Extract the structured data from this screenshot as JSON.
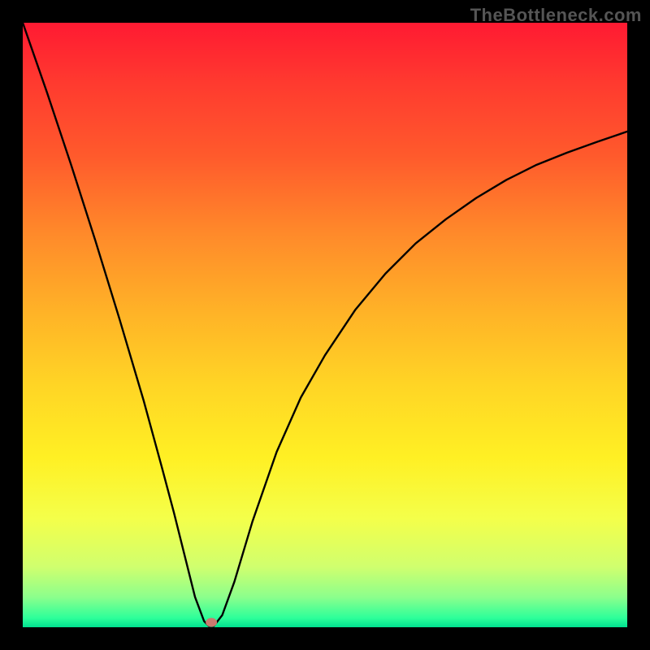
{
  "watermark": "TheBottleneck.com",
  "chart_data": {
    "type": "line",
    "title": "",
    "xlabel": "",
    "ylabel": "",
    "xlim": [
      0,
      100
    ],
    "ylim": [
      0,
      100
    ],
    "x": [
      0,
      4,
      8,
      12,
      16,
      20,
      23,
      25,
      27,
      28.5,
      30,
      30.8,
      31.6,
      33,
      35,
      38,
      42,
      46,
      50,
      55,
      60,
      65,
      70,
      75,
      80,
      85,
      90,
      95,
      100
    ],
    "y": [
      100,
      88.5,
      76.5,
      64,
      51,
      37.5,
      26.5,
      19,
      11,
      5,
      1,
      0.2,
      0.2,
      2,
      7.5,
      17.5,
      29,
      38,
      45,
      52.5,
      58.5,
      63.5,
      67.5,
      71,
      74,
      76.5,
      78.5,
      80.3,
      82
    ],
    "marker": {
      "x": 31.2,
      "y": 0.8
    },
    "flat_bottom": {
      "x0": 28.5,
      "x1": 31.6,
      "y": 0.2
    },
    "gradient_stops": [
      {
        "offset": 0.0,
        "color": "#ff1a32"
      },
      {
        "offset": 0.1,
        "color": "#ff3a2f"
      },
      {
        "offset": 0.22,
        "color": "#ff5a2c"
      },
      {
        "offset": 0.35,
        "color": "#ff8a2a"
      },
      {
        "offset": 0.48,
        "color": "#ffb327"
      },
      {
        "offset": 0.6,
        "color": "#ffd525"
      },
      {
        "offset": 0.72,
        "color": "#fff024"
      },
      {
        "offset": 0.82,
        "color": "#f4ff4a"
      },
      {
        "offset": 0.9,
        "color": "#d0ff6e"
      },
      {
        "offset": 0.95,
        "color": "#8cff8c"
      },
      {
        "offset": 0.985,
        "color": "#2cff9a"
      },
      {
        "offset": 1.0,
        "color": "#00e090"
      }
    ]
  }
}
